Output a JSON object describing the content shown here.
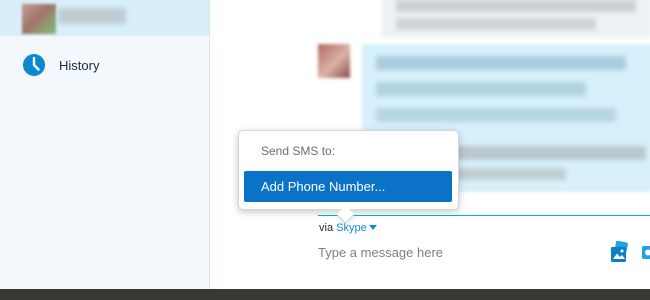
{
  "sidebar": {
    "history_label": "History"
  },
  "popup": {
    "title": "Send SMS to:",
    "option": "Add Phone Number..."
  },
  "compose": {
    "via_prefix": "via",
    "service": "Skype",
    "placeholder": "Type a message here"
  },
  "icons": {
    "history": "clock-icon",
    "service_dropdown": "caret-down-icon",
    "media": "media-gallery-icon",
    "more": "partial-icon"
  },
  "colors": {
    "accent": "#00aff0",
    "selected_option": "#0a73c7",
    "link": "#0b8fd6",
    "incoming_bubble": "#d7f0fb"
  }
}
